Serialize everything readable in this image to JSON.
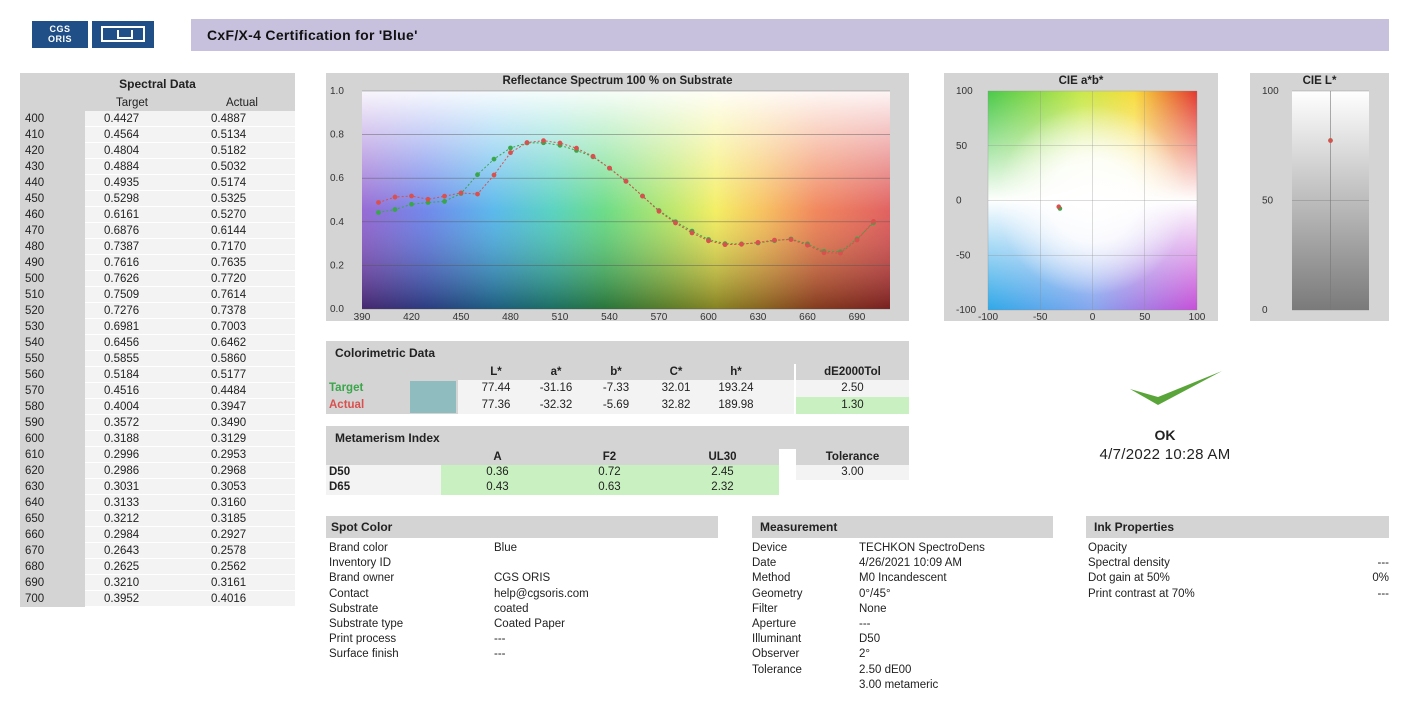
{
  "header": {
    "logo_text_top": "CGS",
    "logo_text_bottom": "ORIS",
    "title": "CxF/X-4 Certification for 'Blue'"
  },
  "spectral": {
    "title": "Spectral Data",
    "col_target": "Target",
    "col_actual": "Actual",
    "rows": [
      [
        "400",
        "0.4427",
        "0.4887"
      ],
      [
        "410",
        "0.4564",
        "0.5134"
      ],
      [
        "420",
        "0.4804",
        "0.5182"
      ],
      [
        "430",
        "0.4884",
        "0.5032"
      ],
      [
        "440",
        "0.4935",
        "0.5174"
      ],
      [
        "450",
        "0.5298",
        "0.5325"
      ],
      [
        "460",
        "0.6161",
        "0.5270"
      ],
      [
        "470",
        "0.6876",
        "0.6144"
      ],
      [
        "480",
        "0.7387",
        "0.7170"
      ],
      [
        "490",
        "0.7616",
        "0.7635"
      ],
      [
        "500",
        "0.7626",
        "0.7720"
      ],
      [
        "510",
        "0.7509",
        "0.7614"
      ],
      [
        "520",
        "0.7276",
        "0.7378"
      ],
      [
        "530",
        "0.6981",
        "0.7003"
      ],
      [
        "540",
        "0.6456",
        "0.6462"
      ],
      [
        "550",
        "0.5855",
        "0.5860"
      ],
      [
        "560",
        "0.5184",
        "0.5177"
      ],
      [
        "570",
        "0.4516",
        "0.4484"
      ],
      [
        "580",
        "0.4004",
        "0.3947"
      ],
      [
        "590",
        "0.3572",
        "0.3490"
      ],
      [
        "600",
        "0.3188",
        "0.3129"
      ],
      [
        "610",
        "0.2996",
        "0.2953"
      ],
      [
        "620",
        "0.2986",
        "0.2968"
      ],
      [
        "630",
        "0.3031",
        "0.3053"
      ],
      [
        "640",
        "0.3133",
        "0.3160"
      ],
      [
        "650",
        "0.3212",
        "0.3185"
      ],
      [
        "660",
        "0.2984",
        "0.2927"
      ],
      [
        "670",
        "0.2643",
        "0.2578"
      ],
      [
        "680",
        "0.2625",
        "0.2562"
      ],
      [
        "690",
        "0.3210",
        "0.3161"
      ],
      [
        "700",
        "0.3952",
        "0.4016"
      ]
    ]
  },
  "chart_data": [
    {
      "type": "scatter",
      "title": "Reflectance Spectrum 100 % on Substrate",
      "xlim": [
        390,
        710
      ],
      "ylim": [
        0.0,
        1.0
      ],
      "x_ticks": [
        "390",
        "420",
        "450",
        "480",
        "510",
        "540",
        "570",
        "600",
        "630",
        "660",
        "690"
      ],
      "y_ticks": [
        "0.0",
        "0.2",
        "0.4",
        "0.6",
        "0.8",
        "1.0"
      ],
      "x": [
        400,
        410,
        420,
        430,
        440,
        450,
        460,
        470,
        480,
        490,
        500,
        510,
        520,
        530,
        540,
        550,
        560,
        570,
        580,
        590,
        600,
        610,
        620,
        630,
        640,
        650,
        660,
        670,
        680,
        690,
        700
      ],
      "series": [
        {
          "name": "Target",
          "color": "#3aa64a",
          "values": [
            0.4427,
            0.4564,
            0.4804,
            0.4884,
            0.4935,
            0.5298,
            0.6161,
            0.6876,
            0.7387,
            0.7616,
            0.7626,
            0.7509,
            0.7276,
            0.6981,
            0.6456,
            0.5855,
            0.5184,
            0.4516,
            0.4004,
            0.3572,
            0.3188,
            0.2996,
            0.2986,
            0.3031,
            0.3133,
            0.3212,
            0.2984,
            0.2643,
            0.2625,
            0.321,
            0.3952
          ]
        },
        {
          "name": "Actual",
          "color": "#d9504e",
          "values": [
            0.4887,
            0.5134,
            0.5182,
            0.5032,
            0.5174,
            0.5325,
            0.527,
            0.6144,
            0.717,
            0.7635,
            0.772,
            0.7614,
            0.7378,
            0.7003,
            0.6462,
            0.586,
            0.5177,
            0.4484,
            0.3947,
            0.349,
            0.3129,
            0.2953,
            0.2968,
            0.3053,
            0.316,
            0.3185,
            0.2927,
            0.2578,
            0.2562,
            0.3161,
            0.4016
          ]
        }
      ]
    },
    {
      "type": "scatter",
      "title": "CIE a*b*",
      "xlim": [
        -100,
        100
      ],
      "ylim": [
        -100,
        100
      ],
      "x_ticks": [
        "-100",
        "-50",
        "0",
        "50",
        "100"
      ],
      "y_ticks": [
        "-100",
        "-50",
        "0",
        "50",
        "100"
      ],
      "points": [
        {
          "name": "Target",
          "x": -31.16,
          "y": -7.33,
          "color": "#3aa64a"
        },
        {
          "name": "Actual",
          "x": -32.32,
          "y": -5.69,
          "color": "#d9504e"
        }
      ]
    },
    {
      "type": "scatter",
      "title": "CIE L*",
      "ylim": [
        0,
        100
      ],
      "y_ticks": [
        "0",
        "50",
        "100"
      ],
      "points": [
        {
          "name": "Target",
          "y": 77.44,
          "color": "#3aa64a"
        },
        {
          "name": "Actual",
          "y": 77.36,
          "color": "#d9504e"
        }
      ]
    }
  ],
  "colorimetric": {
    "title": "Colorimetric Data",
    "headers": [
      "L*",
      "a*",
      "b*",
      "C*",
      "h*"
    ],
    "tol_header": "dE2000Tol",
    "target_label": "Target",
    "actual_label": "Actual",
    "target": [
      "77.44",
      "-31.16",
      "-7.33",
      "32.01",
      "193.24"
    ],
    "actual": [
      "77.36",
      "-32.32",
      "-5.69",
      "32.82",
      "189.98"
    ],
    "tol_value": "2.50",
    "de_value": "1.30",
    "swatch_color": "#8fbcbe"
  },
  "metamerism": {
    "title": "Metamerism Index",
    "headers": [
      "A",
      "F2",
      "UL30"
    ],
    "tol_header": "Tolerance",
    "rows": [
      {
        "label": "D50",
        "values": [
          "0.36",
          "0.72",
          "2.45"
        ]
      },
      {
        "label": "D65",
        "values": [
          "0.43",
          "0.63",
          "2.32"
        ]
      }
    ],
    "tol_value": "3.00"
  },
  "result": {
    "status": "OK",
    "date": "4/7/2022 10:28 AM",
    "check_color": "#5aa53a"
  },
  "spot_color": {
    "title": "Spot Color",
    "items": [
      [
        "Brand color",
        "Blue"
      ],
      [
        "Inventory ID",
        ""
      ],
      [
        "Brand owner",
        "CGS ORIS"
      ],
      [
        "Contact",
        "help@cgsoris.com"
      ],
      [
        "Substrate",
        "coated"
      ],
      [
        "Substrate type",
        "Coated Paper"
      ],
      [
        "Print process",
        "---"
      ],
      [
        "Surface finish",
        "---"
      ]
    ]
  },
  "measurement": {
    "title": "Measurement",
    "items": [
      [
        "Device",
        "TECHKON SpectroDens"
      ],
      [
        "Date",
        "4/26/2021 10:09 AM"
      ],
      [
        "Method",
        "M0 Incandescent"
      ],
      [
        "Geometry",
        "0°/45°"
      ],
      [
        "Filter",
        "None"
      ],
      [
        "Aperture",
        "---"
      ],
      [
        "Illuminant",
        "D50"
      ],
      [
        "Observer",
        "2°"
      ],
      [
        "Tolerance",
        "2.50 dE00"
      ],
      [
        "",
        "3.00 metameric"
      ]
    ]
  },
  "ink": {
    "title": "Ink Properties",
    "items": [
      [
        "Opacity",
        ""
      ],
      [
        "Spectral density",
        "---"
      ],
      [
        "Dot gain at 50%",
        "0%"
      ],
      [
        "Print contrast at 70%",
        "---"
      ]
    ]
  }
}
